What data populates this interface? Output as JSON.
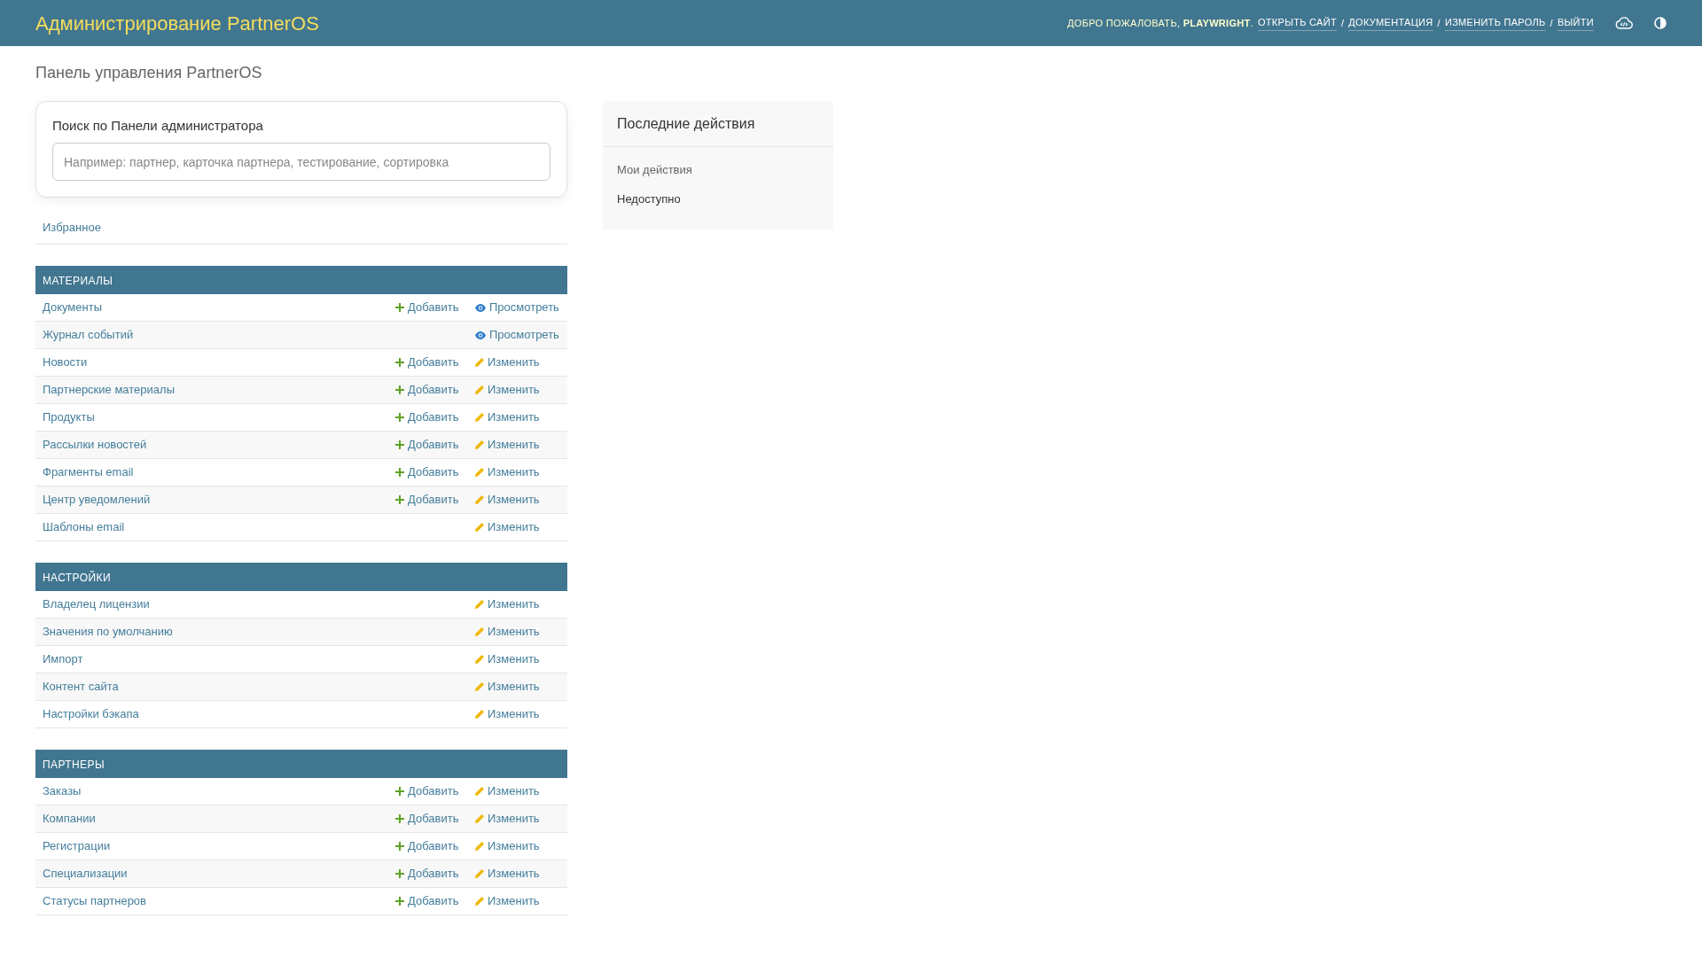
{
  "header": {
    "title": "Администрирование PartnerOS",
    "welcome": "ДОБРО ПОЖАЛОВАТЬ, **PLAYWRIGHT**.",
    "links": [
      "ОТКРЫТЬ САЙТ",
      "ДОКУМЕНТАЦИЯ",
      "ИЗМЕНИТЬ ПАРОЛЬ",
      "ВЫЙТИ"
    ],
    "separator": "/"
  },
  "page_title": "Панель управления PartnerOS",
  "search": {
    "label": "Поиск по Панели администратора",
    "placeholder": "Например: партнер, карточка партнера, тестирование, сортировка"
  },
  "favorites": "Избранное",
  "sections": [
    {
      "title": "МАТЕРИАЛЫ",
      "rows": [
        {
          "name": "Документы",
          "add": "Добавить",
          "action": {
            "kind": "view",
            "label": "Просмотреть"
          }
        },
        {
          "name": "Журнал событий",
          "action": {
            "kind": "view",
            "label": "Просмотреть"
          }
        },
        {
          "name": "Новости",
          "add": "Добавить",
          "action": {
            "kind": "change",
            "label": "Изменить"
          }
        },
        {
          "name": "Партнерские материалы",
          "add": "Добавить",
          "action": {
            "kind": "change",
            "label": "Изменить"
          }
        },
        {
          "name": "Продукты",
          "add": "Добавить",
          "action": {
            "kind": "change",
            "label": "Изменить"
          }
        },
        {
          "name": "Рассылки новостей",
          "add": "Добавить",
          "action": {
            "kind": "change",
            "label": "Изменить"
          }
        },
        {
          "name": "Фрагменты email",
          "add": "Добавить",
          "action": {
            "kind": "change",
            "label": "Изменить"
          }
        },
        {
          "name": "Центр уведомлений",
          "add": "Добавить",
          "action": {
            "kind": "change",
            "label": "Изменить"
          }
        },
        {
          "name": "Шаблоны email",
          "action": {
            "kind": "change",
            "label": "Изменить"
          }
        }
      ]
    },
    {
      "title": "НАСТРОЙКИ",
      "rows": [
        {
          "name": "Владелец лицензии",
          "action": {
            "kind": "change",
            "label": "Изменить"
          }
        },
        {
          "name": "Значения по умолчанию",
          "action": {
            "kind": "change",
            "label": "Изменить"
          }
        },
        {
          "name": "Импорт",
          "action": {
            "kind": "change",
            "label": "Изменить"
          }
        },
        {
          "name": "Контент сайта",
          "action": {
            "kind": "change",
            "label": "Изменить"
          }
        },
        {
          "name": "Настройки бэкапа",
          "action": {
            "kind": "change",
            "label": "Изменить"
          }
        }
      ]
    },
    {
      "title": "ПАРТНЕРЫ",
      "rows": [
        {
          "name": "Заказы",
          "add": "Добавить",
          "action": {
            "kind": "change",
            "label": "Изменить"
          }
        },
        {
          "name": "Компании",
          "add": "Добавить",
          "action": {
            "kind": "change",
            "label": "Изменить"
          }
        },
        {
          "name": "Регистрации",
          "add": "Добавить",
          "action": {
            "kind": "change",
            "label": "Изменить"
          }
        },
        {
          "name": "Специализации",
          "add": "Добавить",
          "action": {
            "kind": "change",
            "label": "Изменить"
          }
        },
        {
          "name": "Статусы партнеров",
          "add": "Добавить",
          "action": {
            "kind": "change",
            "label": "Изменить"
          }
        }
      ]
    }
  ],
  "recent": {
    "title": "Последние действия",
    "subtitle": "Мои действия",
    "empty": "Недоступно"
  }
}
